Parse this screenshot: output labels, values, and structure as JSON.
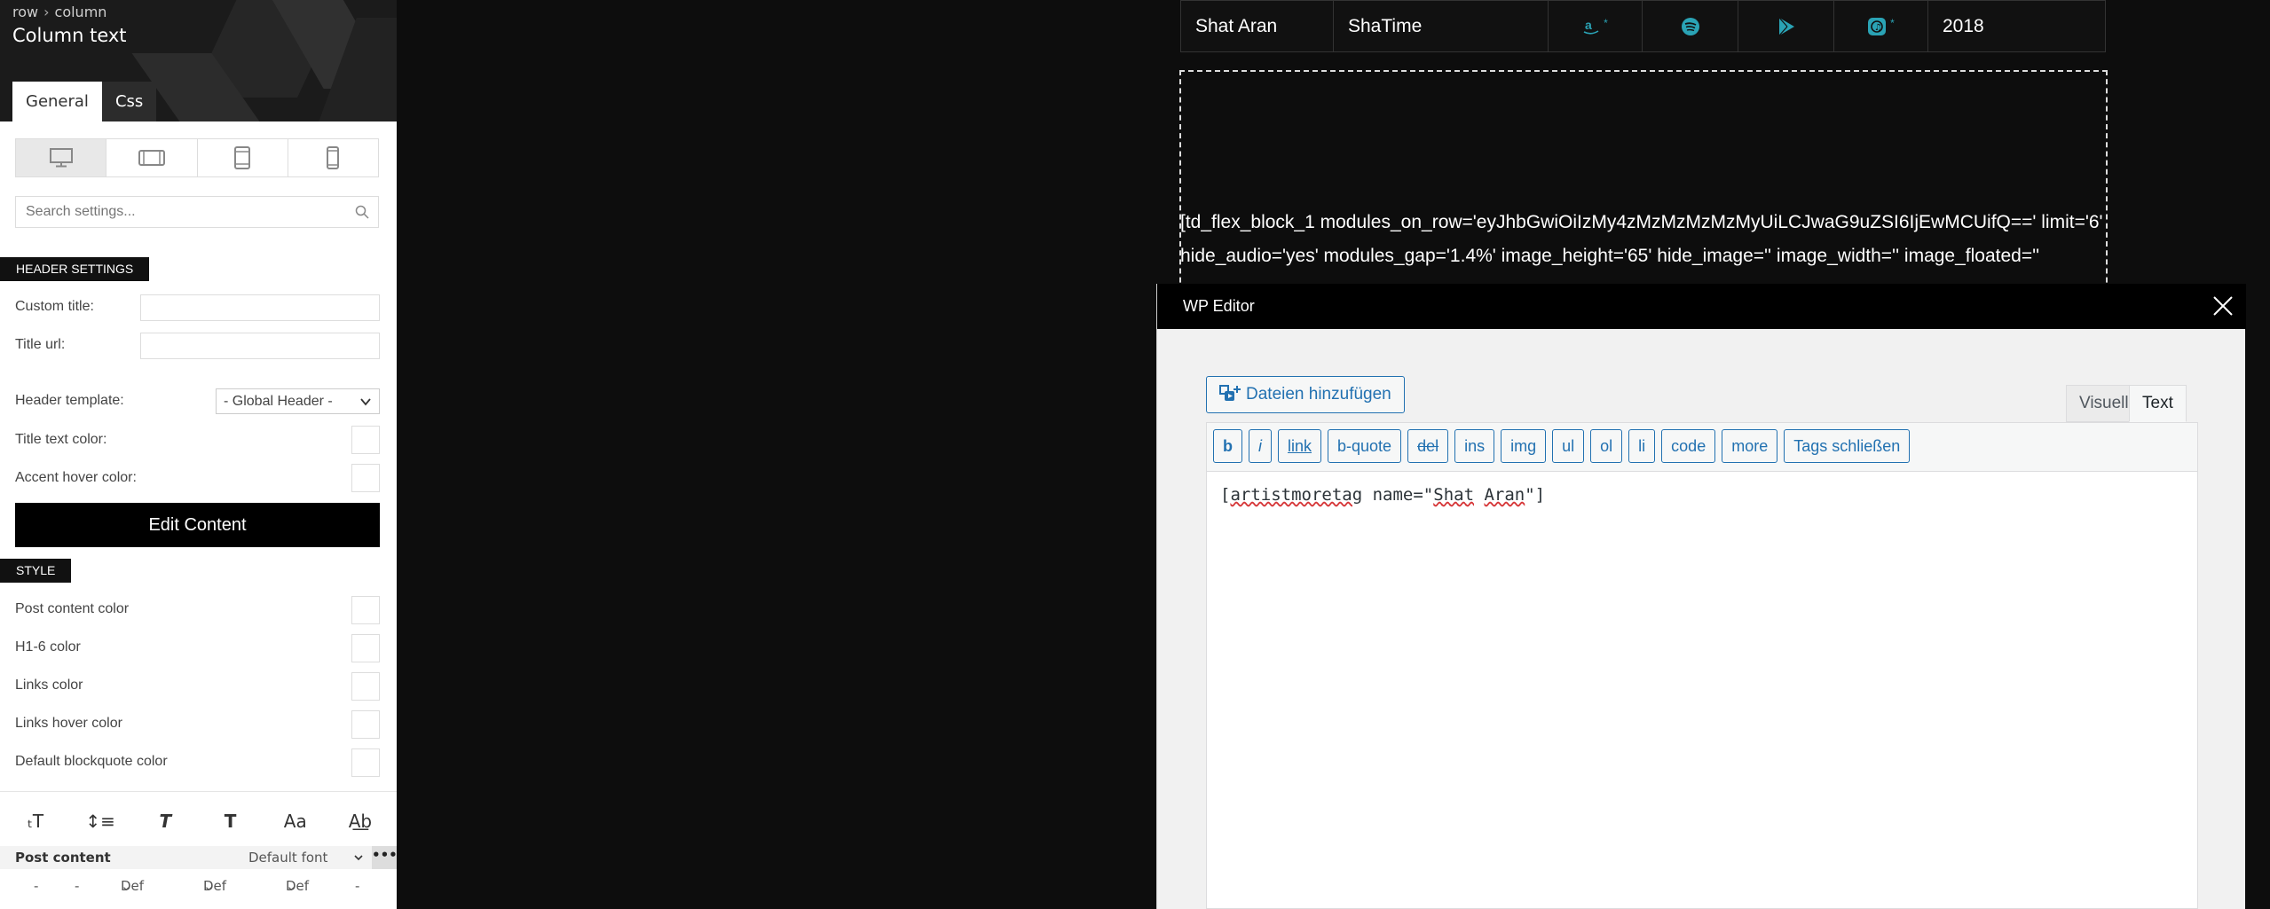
{
  "sidebar": {
    "breadcrumb": [
      "row",
      "column"
    ],
    "title": "Column text",
    "tabs": [
      "General",
      "Css"
    ],
    "search_placeholder": "Search settings...",
    "header_section": "HEADER SETTINGS",
    "custom_title_label": "Custom title:",
    "title_url_label": "Title url:",
    "header_template_label": "Header template:",
    "header_template_value": "- Global Header -",
    "title_text_color_label": "Title text color:",
    "accent_hover_color_label": "Accent hover color:",
    "edit_content_label": "Edit Content",
    "style_section": "STYLE",
    "post_content_color": "Post content color",
    "h16_color": "H1-6 color",
    "links_color": "Links color",
    "links_hover_color": "Links hover color",
    "blockquote_color": "Default blockquote color",
    "post_content_label": "Post content",
    "default_font": "Default font",
    "more_glyph": "•••",
    "def_values": [
      "-",
      "-",
      "Def",
      "Def",
      "Def",
      "-"
    ]
  },
  "music_row": {
    "artist": "Shat Aran",
    "album": "ShaTime",
    "star": "*",
    "year": "2018"
  },
  "shortcode_preview": "[td_flex_block_1 modules_on_row='eyJhbGwiOiIzMy4zMzMzMzMzMyUiLCJwaG9uZSI6IjEwMCUifQ==' limit='6' hide_audio='yes' modules_gap='1.4%' image_height='65' hide_image='' image_width='' image_floated=''",
  "wp_editor": {
    "title": "WP Editor",
    "add_media": "Dateien hinzufügen",
    "tab_visual": "Visuell",
    "tab_text": "Text",
    "quicktags": [
      "b",
      "i",
      "link",
      "b-quote",
      "del",
      "ins",
      "img",
      "ul",
      "ol",
      "li",
      "code",
      "more",
      "Tags schließen"
    ],
    "content_prefix": "[",
    "content_tag": "artistmoretag",
    "content_attr": " name=\"",
    "content_w1": "Shat",
    "content_space": " ",
    "content_w2": "Aran",
    "content_suffix": "\"]"
  },
  "colors": {
    "accent": "#2271b1",
    "sidebar_header": "#1b1b1b",
    "page_bg": "#0d0d0d"
  }
}
